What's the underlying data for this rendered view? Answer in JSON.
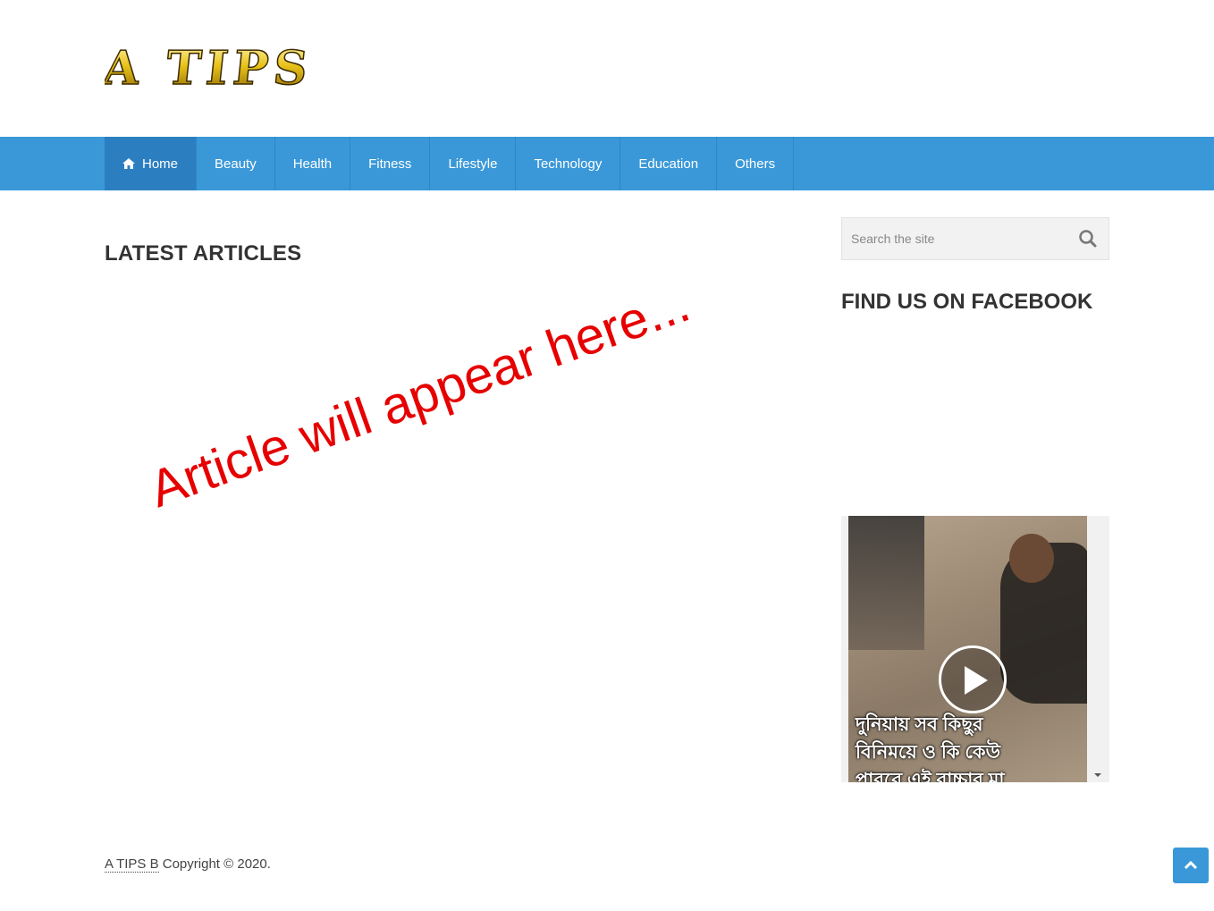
{
  "site": {
    "logo_text": "A TIPS B"
  },
  "nav": {
    "items": [
      {
        "label": "Home",
        "active": true,
        "icon": "home-icon"
      },
      {
        "label": "Beauty"
      },
      {
        "label": "Health"
      },
      {
        "label": "Fitness"
      },
      {
        "label": "Lifestyle"
      },
      {
        "label": "Technology"
      },
      {
        "label": "Education"
      },
      {
        "label": "Others"
      }
    ]
  },
  "main": {
    "section_title": "LATEST ARTICLES",
    "placeholder_text": "Article will appear here..."
  },
  "sidebar": {
    "search_placeholder": "Search the site",
    "search_icon": "search-icon",
    "facebook_title": "FIND US ON FACEBOOK",
    "video_caption": "দুনিয়ায় সব কিছুর\nবিনিময়ে ও কি কেউ\nপারবে এই বাচ্চার মা"
  },
  "footer": {
    "brand": "A TIPS B",
    "copyright": " Copyright © 2020."
  },
  "colors": {
    "nav_bg": "#3a98d8",
    "nav_active": "#2b7fc0",
    "placeholder_red": "#e60000"
  }
}
